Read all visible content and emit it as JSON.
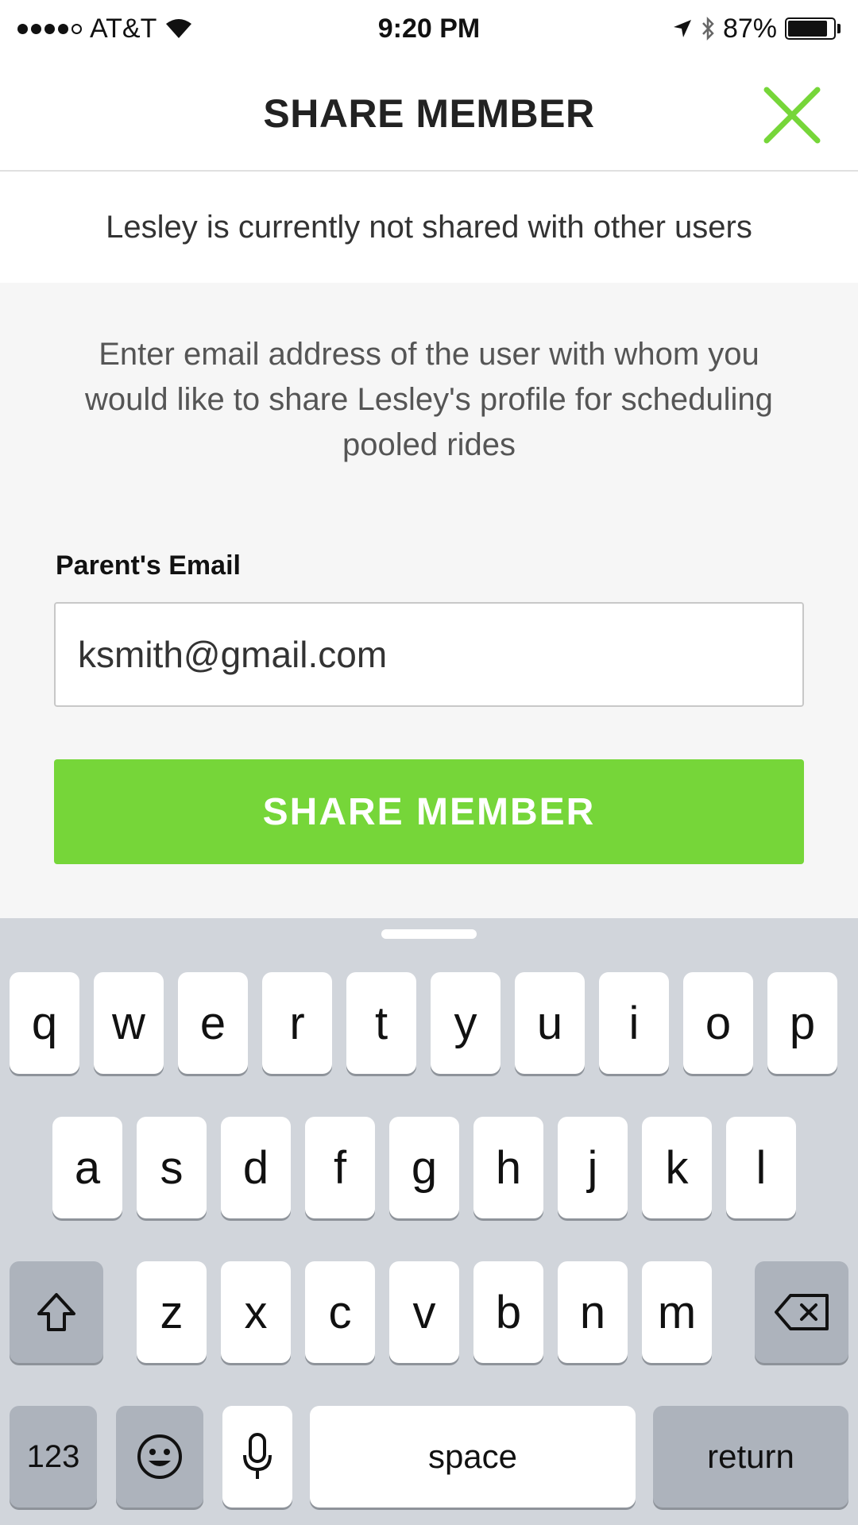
{
  "status_bar": {
    "carrier": "AT&T",
    "time": "9:20 PM",
    "battery": "87%",
    "battery_level": 0.87,
    "signal_bars_filled": 4,
    "signal_bars_total": 5
  },
  "header": {
    "title": "SHARE MEMBER",
    "close_icon": "close-x-icon",
    "accent_color": "#76d639"
  },
  "share_status": "Lesley is currently not shared with other users",
  "instructions": "Enter email address of the user with whom you would like to share Lesley's profile for scheduling pooled rides",
  "form": {
    "label": "Parent's Email",
    "email_value": "ksmith@gmail.com",
    "button_label": "SHARE MEMBER"
  },
  "keyboard": {
    "row1": [
      "q",
      "w",
      "e",
      "r",
      "t",
      "y",
      "u",
      "i",
      "o",
      "p"
    ],
    "row2": [
      "a",
      "s",
      "d",
      "f",
      "g",
      "h",
      "j",
      "k",
      "l"
    ],
    "row3": [
      "z",
      "x",
      "c",
      "v",
      "b",
      "n",
      "m"
    ],
    "shift_icon": "shift-arrow-icon",
    "delete_icon": "backspace-icon",
    "numbers_label": "123",
    "emoji_icon": "emoji-icon",
    "mic_icon": "microphone-icon",
    "space_label": "space",
    "return_label": "return"
  }
}
